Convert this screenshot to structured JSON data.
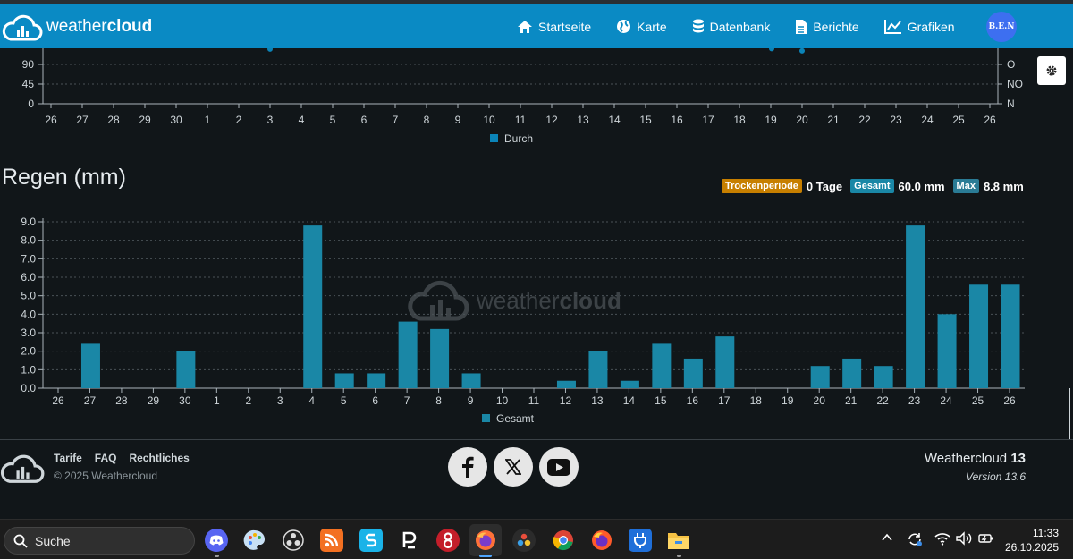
{
  "navbar": {
    "logo_text_light": "weather",
    "logo_text_bold": "cloud",
    "items": [
      {
        "label": "Startseite",
        "icon": "home-icon"
      },
      {
        "label": "Karte",
        "icon": "globe-icon"
      },
      {
        "label": "Datenbank",
        "icon": "database-icon"
      },
      {
        "label": "Berichte",
        "icon": "document-icon"
      },
      {
        "label": "Grafiken",
        "icon": "line-chart-icon"
      }
    ],
    "avatar_text": "B.E.N"
  },
  "wind_chart": {
    "y_left_ticks": [
      "90",
      "45",
      "0"
    ],
    "y_right_ticks": [
      "O",
      "NO",
      "N"
    ],
    "legend": "Durch",
    "color": "#0b84b8"
  },
  "rain": {
    "title": "Regen (mm)",
    "badges": [
      {
        "label": "Trockenperiode",
        "value": "0 Tage",
        "color": "#c77f00"
      },
      {
        "label": "Gesamt",
        "value": "60.0 mm",
        "color": "#1a87a6"
      },
      {
        "label": "Max",
        "value": "8.8 mm",
        "color": "#2a7b95"
      }
    ],
    "watermark_light": "weather",
    "watermark_bold": "cloud"
  },
  "chart_data": [
    {
      "type": "scatter",
      "categories": [
        "26",
        "27",
        "28",
        "29",
        "30",
        "1",
        "2",
        "3",
        "4",
        "5",
        "6",
        "7",
        "8",
        "9",
        "10",
        "11",
        "12",
        "13",
        "14",
        "15",
        "16",
        "17",
        "18",
        "19",
        "20",
        "21",
        "22",
        "23",
        "24",
        "25",
        "26"
      ],
      "legend": [
        "Durch"
      ],
      "ylim": [
        0,
        90
      ],
      "y_ticks_left": [
        0,
        45,
        90
      ],
      "y_ticks_right": [
        "N",
        "NO",
        "O"
      ],
      "series": [
        {
          "name": "Durch",
          "points": [
            {
              "x": "3",
              "y": 125
            },
            {
              "x": "19",
              "y": 126
            },
            {
              "x": "20",
              "y": 121
            }
          ]
        }
      ],
      "grid": true,
      "legend_position": "bottom"
    },
    {
      "type": "bar",
      "categories": [
        "26",
        "27",
        "28",
        "29",
        "30",
        "1",
        "2",
        "3",
        "4",
        "5",
        "6",
        "7",
        "8",
        "9",
        "10",
        "11",
        "12",
        "13",
        "14",
        "15",
        "16",
        "17",
        "18",
        "19",
        "20",
        "21",
        "22",
        "23",
        "24",
        "25",
        "26"
      ],
      "series": [
        {
          "name": "Gesamt",
          "values": [
            0,
            2.4,
            0,
            0,
            2.0,
            0,
            0,
            0,
            8.8,
            0.8,
            0.8,
            3.6,
            3.2,
            0.8,
            0,
            0,
            0.4,
            2.0,
            0.4,
            2.4,
            1.6,
            2.8,
            0,
            0,
            1.2,
            1.6,
            1.2,
            8.8,
            4.0,
            5.6,
            5.6
          ]
        }
      ],
      "ylim": [
        0,
        9
      ],
      "y_ticks": [
        "0.0",
        "1.0",
        "2.0",
        "3.0",
        "4.0",
        "5.0",
        "6.0",
        "7.0",
        "8.0",
        "9.0"
      ],
      "grid": true,
      "legend_position": "bottom",
      "color": "#1a87a6"
    }
  ],
  "footer": {
    "links": [
      "Tarife",
      "FAQ",
      "Rechtliches"
    ],
    "copyright": "© 2025 Weathercloud",
    "brand_name": "Weathercloud",
    "brand_number": "13",
    "version": "Version 13.6",
    "social": [
      "facebook-icon",
      "x-icon",
      "youtube-icon"
    ]
  },
  "taskbar": {
    "search_placeholder": "Suche",
    "time": "11:33",
    "date": "26.10.2025"
  }
}
